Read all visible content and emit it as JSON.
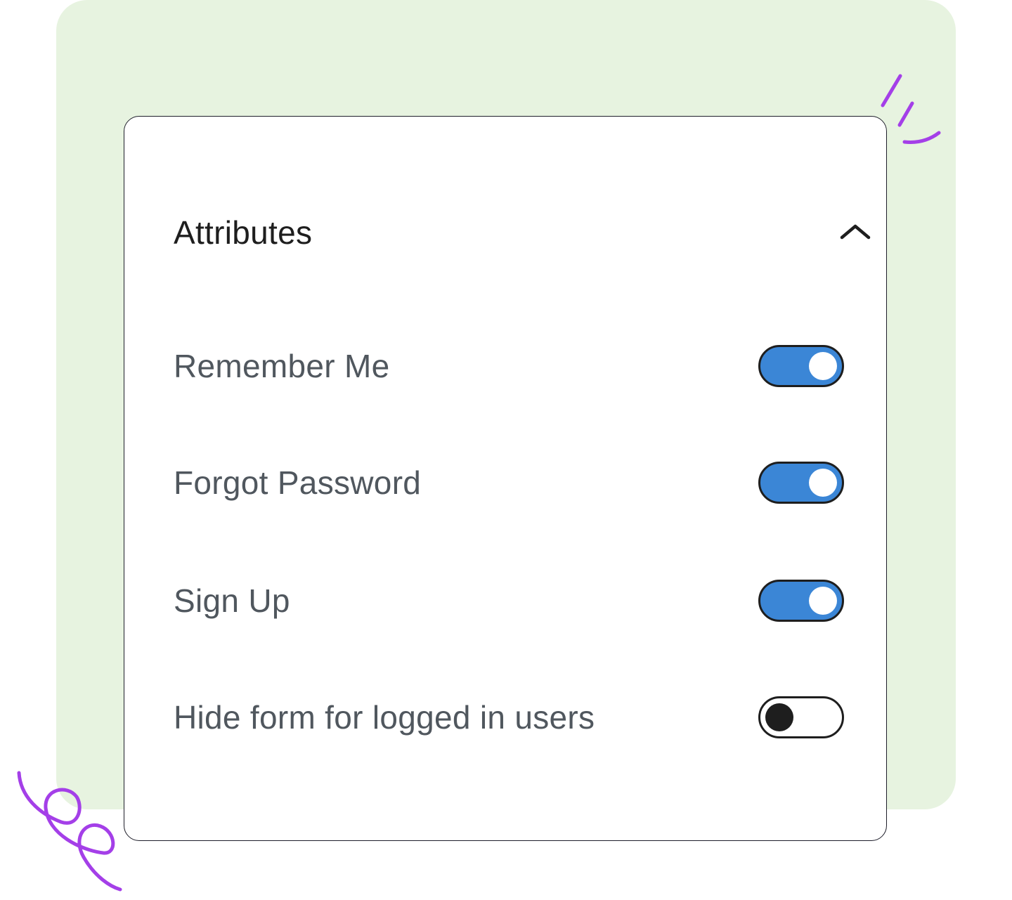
{
  "panel": {
    "title": "Attributes",
    "collapse_icon": "chevron-up-icon"
  },
  "settings": [
    {
      "label": "Remember Me",
      "enabled": true
    },
    {
      "label": "Forgot Password",
      "enabled": true
    },
    {
      "label": "Sign Up",
      "enabled": true
    },
    {
      "label": "Hide form for logged in users",
      "enabled": false
    }
  ],
  "colors": {
    "background_panel": "#e7f3e0",
    "toggle_on": "#3b86d6",
    "toggle_border": "#1e1e1e",
    "decoration": "#a43fe8"
  }
}
